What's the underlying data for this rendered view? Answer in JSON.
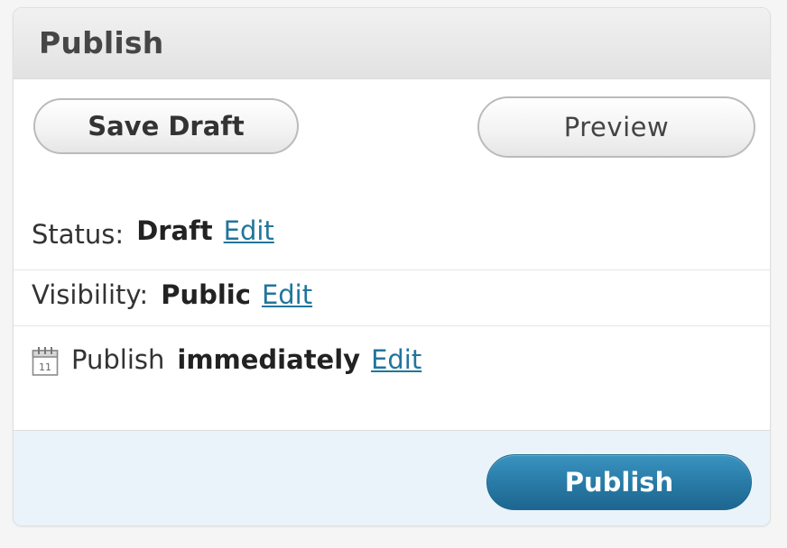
{
  "box": {
    "title": "Publish"
  },
  "actions": {
    "save_draft_label": "Save Draft",
    "preview_label": "Preview"
  },
  "status": {
    "label": "Status:",
    "value": "Draft",
    "edit_label": "Edit"
  },
  "visibility": {
    "label": "Visibility:",
    "value": "Public",
    "edit_label": "Edit"
  },
  "schedule": {
    "icon": "calendar-icon",
    "calendar_day": "11",
    "label": "Publish",
    "value": "immediately",
    "edit_label": "Edit"
  },
  "footer": {
    "publish_label": "Publish"
  },
  "colors": {
    "link": "#21759b",
    "publish_button": "#2a7ea9",
    "footer_background": "#eaf2fa",
    "header_background": "#e9e9e9"
  }
}
